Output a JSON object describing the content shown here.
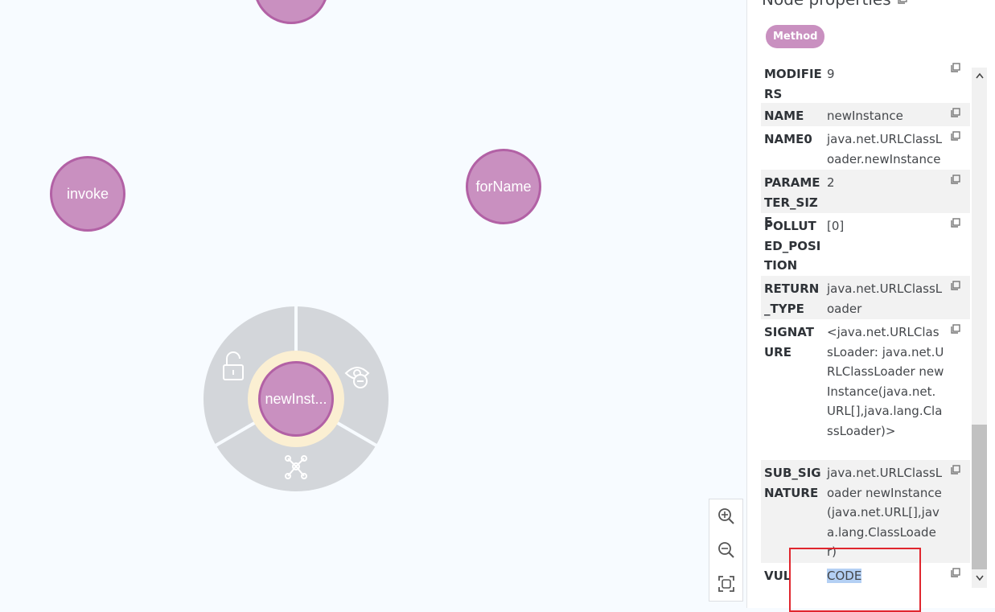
{
  "graph": {
    "nodes": [
      {
        "id": "top",
        "label": ""
      },
      {
        "id": "invoke",
        "label": "invoke"
      },
      {
        "id": "forName",
        "label": "forName"
      },
      {
        "id": "newInstance",
        "label": "newInst..."
      }
    ],
    "ring_menu": {
      "items": [
        "unlock-icon",
        "hide-icon",
        "expand-relationships-icon"
      ]
    },
    "zoom_controls": [
      "zoom-in-icon",
      "zoom-out-icon",
      "fit-view-icon"
    ]
  },
  "panel": {
    "title": "Node properties",
    "badge": "Method",
    "properties": [
      {
        "key": "MODIFIERS",
        "value": "9"
      },
      {
        "key": "NAME",
        "value": "newInstance"
      },
      {
        "key": "NAME0",
        "value": "java.net.URLClassLoader.newInstance"
      },
      {
        "key": "PARAMETER_SIZE",
        "value": "2"
      },
      {
        "key": "POLLUTED_POSITION",
        "value": "[0]"
      },
      {
        "key": "RETURN_TYPE",
        "value": "java.net.URLClassLoader"
      },
      {
        "key": "SIGNATURE",
        "value": "<java.net.URLClassLoader: java.net.URLClassLoader newInstance(java.net.URL[],java.lang.ClassLoader)>"
      },
      {
        "key": "SUB_SIGNATURE",
        "value": "java.net.URLClassLoader newInstance(java.net.URL[],java.lang.ClassLoader)"
      },
      {
        "key": "VUL",
        "value": "CODE"
      }
    ]
  },
  "colors": {
    "node_fill": "#c990c0",
    "node_border": "#b261a5",
    "ring": "#d3d6da",
    "selected_halo": "#fbefd2",
    "highlight": "#e0262e"
  }
}
